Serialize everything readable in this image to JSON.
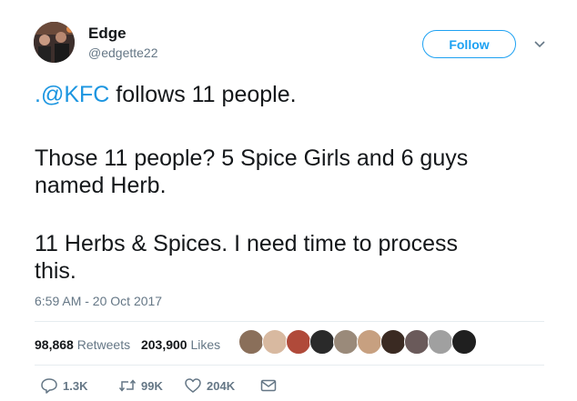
{
  "user": {
    "display_name": "Edge",
    "handle": "@edgette22"
  },
  "follow_button": {
    "label": "Follow",
    "color": "#1da1f2"
  },
  "tweet": {
    "line1_mention": ".@KFC",
    "line1_rest": " follows 11 people.",
    "line2": "Those 11 people? 5 Spice Girls and 6 guys",
    "line3": "named Herb.",
    "line4": "11 Herbs & Spices. I need time to process",
    "line5": "this."
  },
  "timestamp": "6:59 AM - 20 Oct 2017",
  "stats": {
    "retweets_count": "98,868",
    "retweets_label": "Retweets",
    "likes_count": "203,900",
    "likes_label": "Likes"
  },
  "liker_avatar_count": 10,
  "actions": {
    "reply_count": "1.3K",
    "retweet_count": "99K",
    "like_count": "204K"
  },
  "colors": {
    "text": "#14171a",
    "secondary": "#657786",
    "link": "#1b95e0",
    "divider": "#e6ecf0"
  }
}
